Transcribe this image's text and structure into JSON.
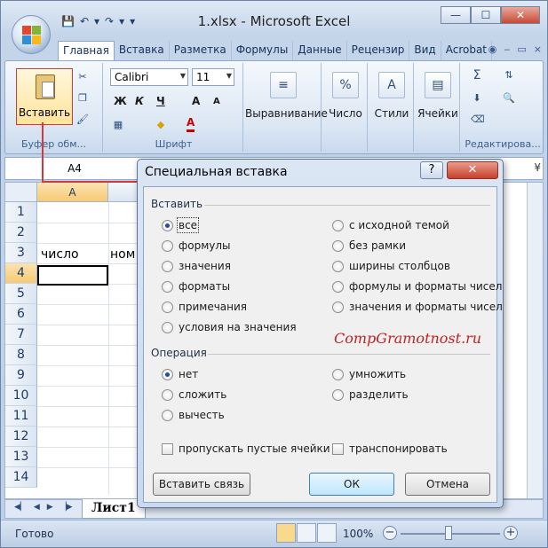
{
  "window": {
    "title": "1.xlsx - Microsoft Excel",
    "minimize": "—",
    "maximize": "☐",
    "close": "✕"
  },
  "qat": {
    "save": "💾",
    "undo": "↶",
    "redo": "↷"
  },
  "ribbon": {
    "tabs": [
      "Главная",
      "Вставка",
      "Разметка",
      "Формулы",
      "Данные",
      "Рецензир",
      "Вид",
      "Acrobat"
    ],
    "clipboard": {
      "paste_label": "Вставить",
      "group_label": "Буфер обм..."
    },
    "font": {
      "name": "Calibri",
      "size": "11",
      "bold": "Ж",
      "italic": "К",
      "underline": "Ч",
      "grow": "A",
      "shrink": "A",
      "color_a": "A",
      "group_label": "Шрифт"
    },
    "alignment": {
      "label": "Выравнивание"
    },
    "number": {
      "label": "Число",
      "icon": "%"
    },
    "styles": {
      "label": "Стили"
    },
    "cells": {
      "label": "Ячейки"
    },
    "editing": {
      "sum": "Σ",
      "group_label": "Редактирова..."
    }
  },
  "formula_bar": {
    "name_box": "A4",
    "expand": "¥"
  },
  "sheet": {
    "columns": [
      "A"
    ],
    "rows": [
      "1",
      "2",
      "3",
      "4",
      "5",
      "6",
      "7",
      "8",
      "9",
      "10",
      "11",
      "12",
      "13",
      "14"
    ],
    "cells": {
      "a3": "число",
      "b3": "ном"
    },
    "tab": "Лист1"
  },
  "status": {
    "ready": "Готово",
    "zoom": "100%",
    "minus": "−",
    "plus": "+"
  },
  "dialog": {
    "title": "Специальная вставка",
    "help": "?",
    "close": "✕",
    "paste_section": "Вставить",
    "paste_options_left": [
      "все",
      "формулы",
      "значения",
      "форматы",
      "примечания",
      "условия на значения"
    ],
    "paste_options_right": [
      "с исходной темой",
      "без рамки",
      "ширины столбцов",
      "формулы и форматы чисел",
      "значения и форматы чисел"
    ],
    "operation_section": "Операция",
    "operation_left": [
      "нет",
      "сложить",
      "вычесть"
    ],
    "operation_right": [
      "умножить",
      "разделить"
    ],
    "skip_blanks": "пропускать пустые ячейки",
    "transpose": "транспонировать",
    "paste_link": "Вставить связь",
    "ok": "ОК",
    "cancel": "Отмена",
    "watermark": "CompGramotnost.ru"
  }
}
